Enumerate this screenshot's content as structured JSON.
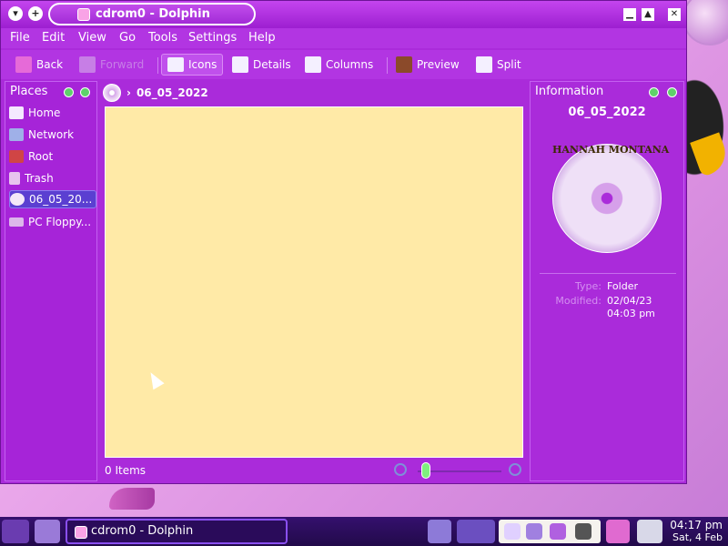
{
  "window": {
    "title": "cdrom0 - Dolphin"
  },
  "menubar": {
    "items": [
      "File",
      "Edit",
      "View",
      "Go",
      "Tools",
      "Settings",
      "Help"
    ]
  },
  "toolbar": {
    "back": "Back",
    "forward": "Forward",
    "icons": "Icons",
    "details": "Details",
    "columns": "Columns",
    "preview": "Preview",
    "split": "Split"
  },
  "places": {
    "title": "Places",
    "items": [
      {
        "label": "Home",
        "icon": "home-icon"
      },
      {
        "label": "Network",
        "icon": "network-icon"
      },
      {
        "label": "Root",
        "icon": "root-folder-icon"
      },
      {
        "label": "Trash",
        "icon": "trash-icon"
      },
      {
        "label": "06_05_20...",
        "icon": "cdrom-icon"
      },
      {
        "label": "PC Floppy...",
        "icon": "floppy-icon"
      }
    ]
  },
  "breadcrumb": {
    "current": "06_05_2022"
  },
  "main": {
    "status": "0 Items"
  },
  "info": {
    "title": "Information",
    "name": "06_05_2022",
    "type_label": "Type:",
    "type_value": "Folder",
    "modified_label": "Modified:",
    "modified_value_date": "02/04/23",
    "modified_value_time": "04:03 pm",
    "logo_text": "HANNAH MONTANA"
  },
  "taskbar": {
    "window_label": "cdrom0 - Dolphin",
    "time": "04:17 pm",
    "date": "Sat, 4 Feb"
  }
}
